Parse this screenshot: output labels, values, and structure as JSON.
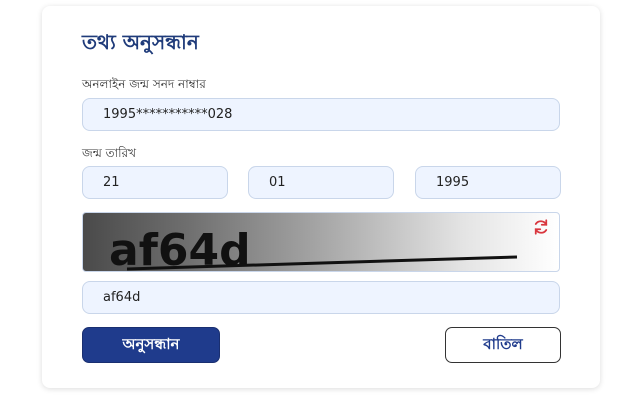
{
  "form": {
    "title": "তথ্য অনুসন্ধান",
    "birth_reg_label": "অনলাইন জন্ম সনদ নাম্বার",
    "birth_reg_value": "1995***********028",
    "dob_label": "জন্ম তারিখ",
    "dob_day": "21",
    "dob_month": "01",
    "dob_year": "1995",
    "captcha_text": "af64d",
    "captcha_input_value": "af64d",
    "search_label": "অনুসন্ধান",
    "cancel_label": "বাতিল"
  },
  "icons": {
    "refresh": "refresh-icon"
  },
  "colors": {
    "primary": "#1f3b8c",
    "input_bg": "#eef4ff",
    "refresh": "#d9363e"
  }
}
